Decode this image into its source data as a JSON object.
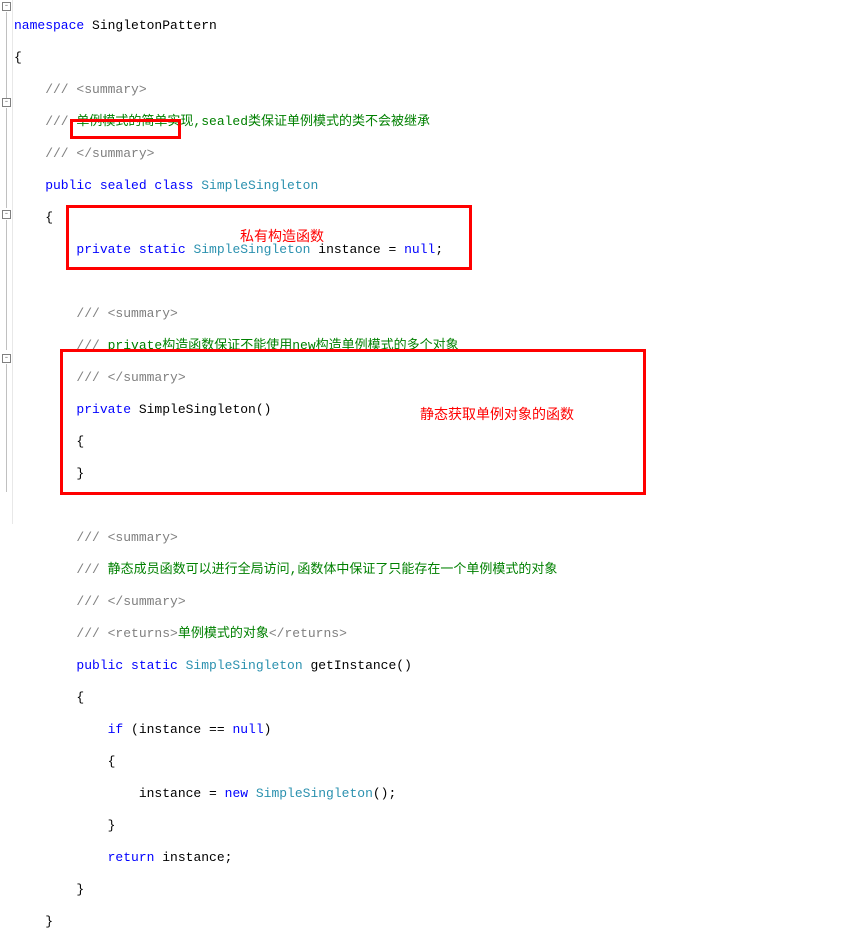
{
  "code": {
    "l1_ns": "namespace",
    "l1_name": " SingletonPattern",
    "l2": "{",
    "l3a": "    /// ",
    "l3b": "<summary>",
    "l4a": "    ///",
    "l4b": " 单例模式的简单实现,sealed类保证单例模式的类不会被继承",
    "l5a": "    /// ",
    "l5b": "</summary>",
    "l6a": "    public",
    "l6b": " sealed",
    "l6c": " class",
    "l6d": " SimpleSingleton",
    "l7": "    {",
    "l8a": "        private",
    "l8b": " static",
    "l8c": " SimpleSingleton",
    "l8d": " instance = ",
    "l8e": "null",
    "l8f": ";",
    "l10a": "        /// ",
    "l10b": "<summary>",
    "l11a": "        ///",
    "l11b": " private构造函数保证不能使用new构造单例模式的多个对象",
    "l12a": "        /// ",
    "l12b": "</summary>",
    "l13a": "        private",
    "l13b": " SimpleSingleton()",
    "l14": "        {",
    "l15": "        }",
    "l17a": "        /// ",
    "l17b": "<summary>",
    "l18a": "        ///",
    "l18b": " 静态成员函数可以进行全局访问,函数体中保证了只能存在一个单例模式的对象",
    "l19a": "        /// ",
    "l19b": "</summary>",
    "l20a": "        /// ",
    "l20b": "<returns>",
    "l20c": "单例模式的对象",
    "l20d": "</returns>",
    "l21a": "        public",
    "l21b": " static",
    "l21c": " SimpleSingleton",
    "l21d": " getInstance()",
    "l22": "        {",
    "l23a": "            if",
    "l23b": " (instance == ",
    "l23c": "null",
    "l23d": ")",
    "l24": "            {",
    "l25a": "                instance = ",
    "l25b": "new",
    "l25c": " SimpleSingleton",
    "l25d": "();",
    "l26": "            }",
    "l27a": "            return",
    "l27b": " instance;",
    "l28": "        }",
    "l29": "    }"
  },
  "annotations": {
    "a1": "私有构造函数",
    "a2": "静态获取单例对象的函数"
  }
}
